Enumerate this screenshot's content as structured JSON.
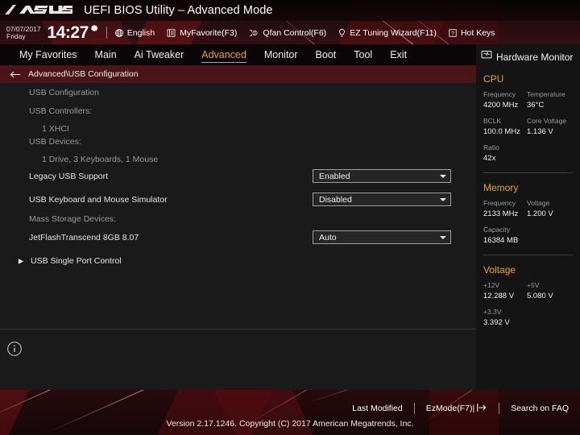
{
  "titlebar": {
    "logo_alt": "ASUS",
    "title": "UEFI BIOS Utility – Advanced Mode"
  },
  "toolbar": {
    "date": "07/07/2017",
    "weekday": "Friday",
    "time": "14:27",
    "gear_icon": "gear-icon",
    "items": [
      {
        "icon": "globe-icon",
        "label": "English"
      },
      {
        "icon": "star-list-icon",
        "label": "MyFavorite(F3)"
      },
      {
        "icon": "fan-icon",
        "label": "Qfan Control(F6)"
      },
      {
        "icon": "bulb-icon",
        "label": "EZ Tuning Wizard(F11)"
      },
      {
        "icon": "question-box-icon",
        "label": "Hot Keys"
      }
    ]
  },
  "tabs": [
    {
      "label": "My Favorites",
      "active": false
    },
    {
      "label": "Main",
      "active": false
    },
    {
      "label": "Ai Tweaker",
      "active": false
    },
    {
      "label": "Advanced",
      "active": true
    },
    {
      "label": "Monitor",
      "active": false
    },
    {
      "label": "Boot",
      "active": false
    },
    {
      "label": "Tool",
      "active": false
    },
    {
      "label": "Exit",
      "active": false
    }
  ],
  "breadcrumb": {
    "back_icon": "back-arrow-icon",
    "path": "Advanced\\USB Configuration"
  },
  "main": {
    "heading": "USB Configuration",
    "controllers_label": "USB Controllers:",
    "controllers_value": "1 XHCI",
    "devices_label": "USB Devices:",
    "devices_value": "1 Drive, 3 Keyboards, 1 Mouse",
    "settings": [
      {
        "label": "Legacy USB Support",
        "value": "Enabled"
      },
      {
        "label": "USB Keyboard and Mouse Simulator",
        "value": "Disabled"
      }
    ],
    "mass_storage_label": "Mass Storage Devices:",
    "mass_storage": [
      {
        "label": "JetFlashTranscend 8GB 8.07",
        "value": "Auto"
      }
    ],
    "submenu": {
      "label": "USB Single Port Control",
      "icon": "submenu-arrow-icon"
    },
    "info_icon": "info-icon"
  },
  "sidebar": {
    "icon": "monitor-icon",
    "title": "Hardware Monitor",
    "sections": [
      {
        "name": "CPU",
        "color": "#e8a317",
        "entries": [
          {
            "key": "Frequency",
            "value": "4200 MHz"
          },
          {
            "key": "Temperature",
            "value": "36°C"
          },
          {
            "key": "BCLK",
            "value": "100.0 MHz"
          },
          {
            "key": "Core Voltage",
            "value": "1.136 V"
          },
          {
            "key": "Ratio",
            "value": "42x"
          }
        ]
      },
      {
        "name": "Memory",
        "color": "#e8a317",
        "entries": [
          {
            "key": "Frequency",
            "value": "2133 MHz"
          },
          {
            "key": "Voltage",
            "value": "1.200 V"
          },
          {
            "key": "Capacity",
            "value": "16384 MB"
          }
        ]
      },
      {
        "name": "Voltage",
        "color": "#e8a317",
        "entries": [
          {
            "key": "+12V",
            "value": "12.288 V"
          },
          {
            "key": "+5V",
            "value": "5.080 V"
          },
          {
            "key": "+3.3V",
            "value": "3.392 V"
          }
        ]
      }
    ]
  },
  "footer": {
    "last_modified": "Last Modified",
    "ezmode": "EzMode(F7)|",
    "ezmode_icon": "exit-arrow-icon",
    "search_faq": "Search on FAQ",
    "version": "Version 2.17.1246. Copyright (C) 2017 American Megatrends, Inc."
  },
  "colors": {
    "accent": "#e8a317",
    "crumb_bg": "#4a1519",
    "panel_bg": "#1a1a1a",
    "sidebar_bg": "#141414"
  }
}
